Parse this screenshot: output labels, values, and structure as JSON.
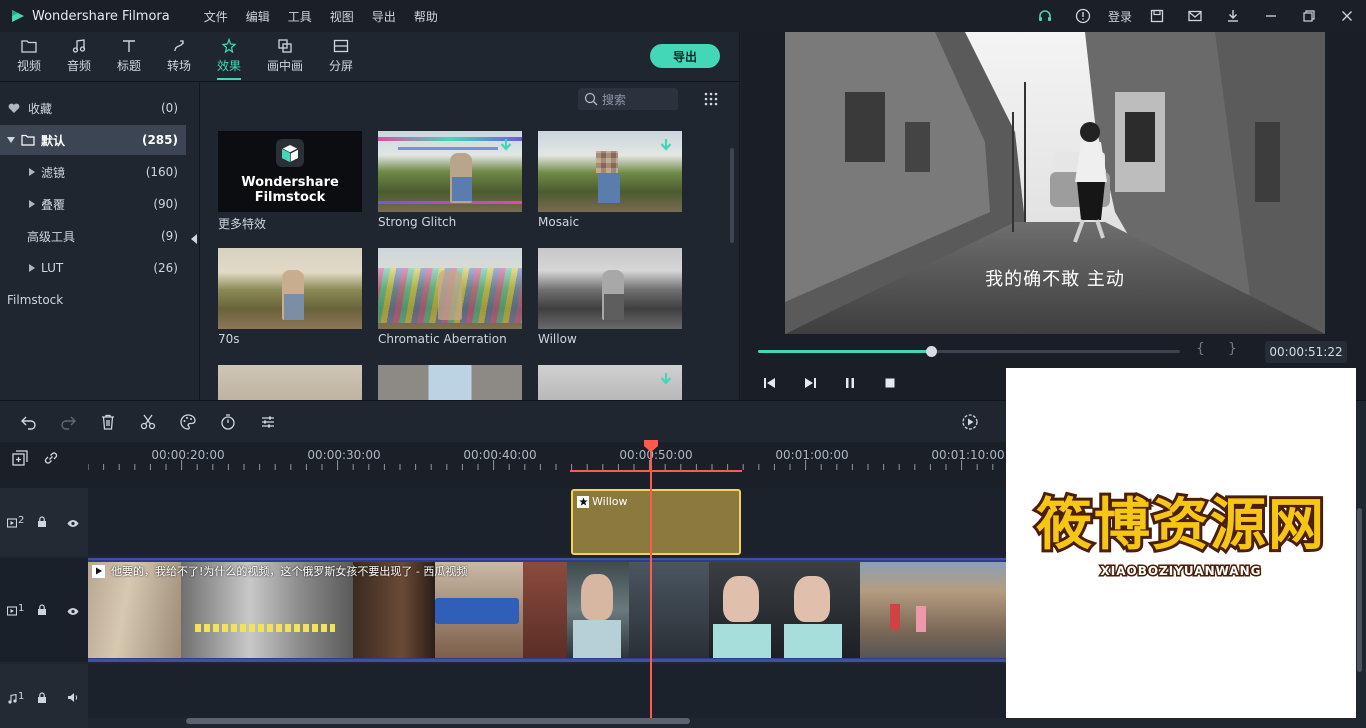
{
  "titlebar": {
    "app_title": "Wondershare Filmora",
    "menu": [
      "文件",
      "编辑",
      "工具",
      "视图",
      "导出",
      "帮助"
    ],
    "login": "登录"
  },
  "tabs": [
    {
      "label": "视频",
      "icon": "folder-icon"
    },
    {
      "label": "音频",
      "icon": "music-note-icon"
    },
    {
      "label": "标题",
      "icon": "text-t-icon"
    },
    {
      "label": "转场",
      "icon": "transition-icon"
    },
    {
      "label": "效果",
      "icon": "effects-icon",
      "active": true
    },
    {
      "label": "画中画",
      "icon": "pip-icon"
    },
    {
      "label": "分屏",
      "icon": "split-screen-icon"
    }
  ],
  "export_label": "导出",
  "sidebar": {
    "items": [
      {
        "label": "收藏",
        "count": "(0)",
        "icon": "heart-icon"
      },
      {
        "label": "默认",
        "count": "(285)",
        "icon": "folder-icon",
        "selected": true
      },
      {
        "label": "滤镜",
        "count": "(160)"
      },
      {
        "label": "叠覆",
        "count": "(90)"
      },
      {
        "label": "高级工具",
        "count": "(9)"
      },
      {
        "label": "LUT",
        "count": "(26)"
      },
      {
        "label": "Filmstock",
        "count": ""
      }
    ]
  },
  "search": {
    "placeholder": "搜索"
  },
  "effects": [
    {
      "caption": "更多特效",
      "brand_line1": "Wondershare",
      "brand_line2": "Filmstock"
    },
    {
      "caption": "Strong Glitch"
    },
    {
      "caption": "Mosaic"
    },
    {
      "caption": "70s"
    },
    {
      "caption": "Chromatic Aberration"
    },
    {
      "caption": "Willow"
    }
  ],
  "preview": {
    "subtitle": "我的确不敢  主动",
    "timecode": "00:00:51:22",
    "progress": 0.41,
    "bracket_in": "{",
    "bracket_out": "}"
  },
  "ruler": {
    "labels": [
      "00:00:20:00",
      "00:00:30:00",
      "00:00:40:00",
      "00:00:50:00",
      "00:01:00:00",
      "00:01:10:00"
    ]
  },
  "tracks": {
    "v2_label": "2",
    "v1_label": "1",
    "a1_label": "1",
    "effect_clip": "Willow",
    "video_clip_title": "他要的，我给不了!为什么的视频，这个俄罗斯女孩不要出现了 - 西瓜视频"
  },
  "watermark": {
    "title": "筱博资源网",
    "subtitle": "XIAOBOZIYUANWANG"
  },
  "colors": {
    "accent": "#43d7b8",
    "playhead": "#ff5a4f",
    "effect_clip": "#8a7a3e",
    "effect_clip_border": "#f5d35a",
    "video_track": "#2f3c87"
  }
}
